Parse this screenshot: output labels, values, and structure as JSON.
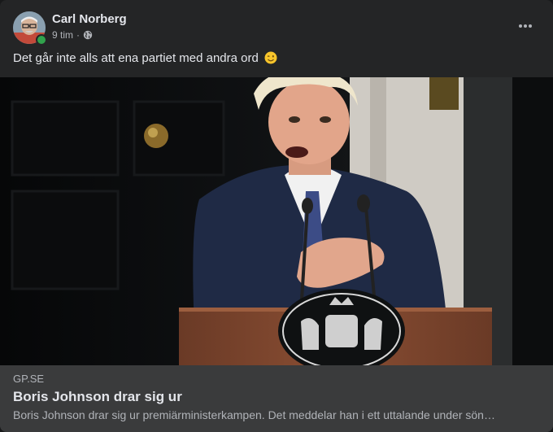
{
  "post": {
    "author": "Carl Norberg",
    "time": "9 tim",
    "separator": "·",
    "privacy_icon": "globe-icon",
    "more_icon": "more-options-icon",
    "caption": "Det går inte alls att ena partiet med andra ord",
    "caption_emoji": "winking-face-emoji",
    "online_status_color": "#31a24c"
  },
  "link_preview": {
    "domain": "GP.SE",
    "title": "Boris Johnson drar sig ur",
    "description": "Boris Johnson drar sig ur premiärministerkampen. Det meddelar han i ett uttalande under sön…"
  }
}
